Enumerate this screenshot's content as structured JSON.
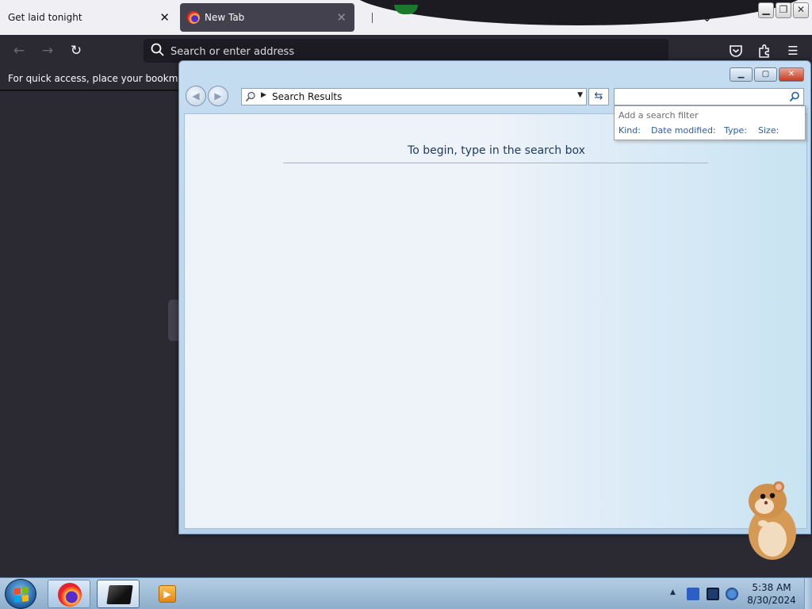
{
  "browser": {
    "tabs": [
      {
        "title": "Get laid tonight",
        "active": false
      },
      {
        "title": "New Tab",
        "active": true
      }
    ],
    "address_placeholder": "Search or enter address",
    "bookmarks_hint": "For quick access, place your bookmarks h",
    "icons": {
      "back": "back-arrow-icon",
      "forward": "forward-arrow-icon",
      "reload": "reload-icon",
      "search": "search-icon",
      "pocket": "pocket-icon",
      "extensions": "extensions-puzzle-icon",
      "menu": "hamburger-menu-icon",
      "list_tabs": "chevron-down-icon"
    }
  },
  "explorer": {
    "address_label": "Search Results",
    "search_value": "",
    "message": "To begin, type in the search box",
    "filter": {
      "title": "Add a search filter",
      "options": [
        "Kind:",
        "Date modified:",
        "Type:",
        "Size:"
      ]
    }
  },
  "taskbar": {
    "time": "5:38 AM",
    "date": "8/30/2024",
    "items": [
      "start-orb",
      "firefox",
      "explorer-window",
      "media-player"
    ]
  },
  "colors": {
    "browser_dark": "#2b2a33",
    "tab_active": "#42414d",
    "explorer_frame": "#c5dcf0",
    "link_blue": "#2a5fa5",
    "close_red": "#c43b1e"
  }
}
